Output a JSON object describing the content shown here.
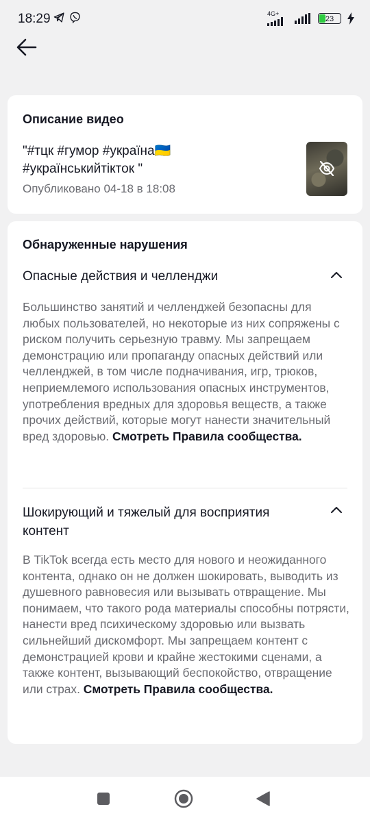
{
  "status_bar": {
    "time": "18:29",
    "network": "4G+",
    "battery": "23",
    "icons": [
      "telegram-icon",
      "viber-icon",
      "signal-icon",
      "wifi-signal-icon",
      "battery-icon",
      "charging-icon"
    ]
  },
  "header": {
    "back_icon": "arrow-left-icon"
  },
  "video_card": {
    "title": "Описание видео",
    "description_line1": "\"#тцк #гумор #україна",
    "description_flag": "🇺🇦",
    "description_line2": "#українськийтікток \"",
    "published": "Опубликовано 04-18 в 18:08",
    "thumbnail_icon": "eye-off-icon"
  },
  "violations": {
    "title": "Обнаруженные нарушения",
    "items": [
      {
        "heading": "Опасные действия и челленджи",
        "text": "Большинство занятий и челленджей безопасны для любых пользователей, но некоторые из них сопряжены с риском получить серьезную травму. Мы запрещаем демонстрацию или пропаганду опасных действий или челленджей, в том числе подначивания, игр, трюков, неприемлемого использования опасных инструментов, употребления вредных для здоровья веществ, а также прочих действий, которые могут нанести значительный вред здоровью.",
        "link": "Смотреть Правила сообщества."
      },
      {
        "heading": "Шокирующий и тяжелый для восприятия контент",
        "text": "В TikTok всегда есть место для нового и неожиданного контента, однако он не должен шокировать, выводить из душевного равновесия или вызывать отвращение. Мы понимаем, что такого рода материалы способны потрясти, нанести вред психическому здоровью или вызвать сильнейший дискомфорт. Мы запрещаем контент с демонстрацией крови и крайне жестокими сценами, а также контент, вызывающий беспокойство, отвращение или страх.",
        "link": "Смотреть Правила сообщества."
      }
    ],
    "chevron_icon": "chevron-up-icon"
  },
  "nav_bar": {
    "icons": [
      "recent-apps-icon",
      "home-icon",
      "back-icon"
    ]
  },
  "colors": {
    "background": "#f1f1f2",
    "card": "#ffffff",
    "text": "#161823",
    "muted": "#6b6c72",
    "battery": "#2ecc40"
  }
}
